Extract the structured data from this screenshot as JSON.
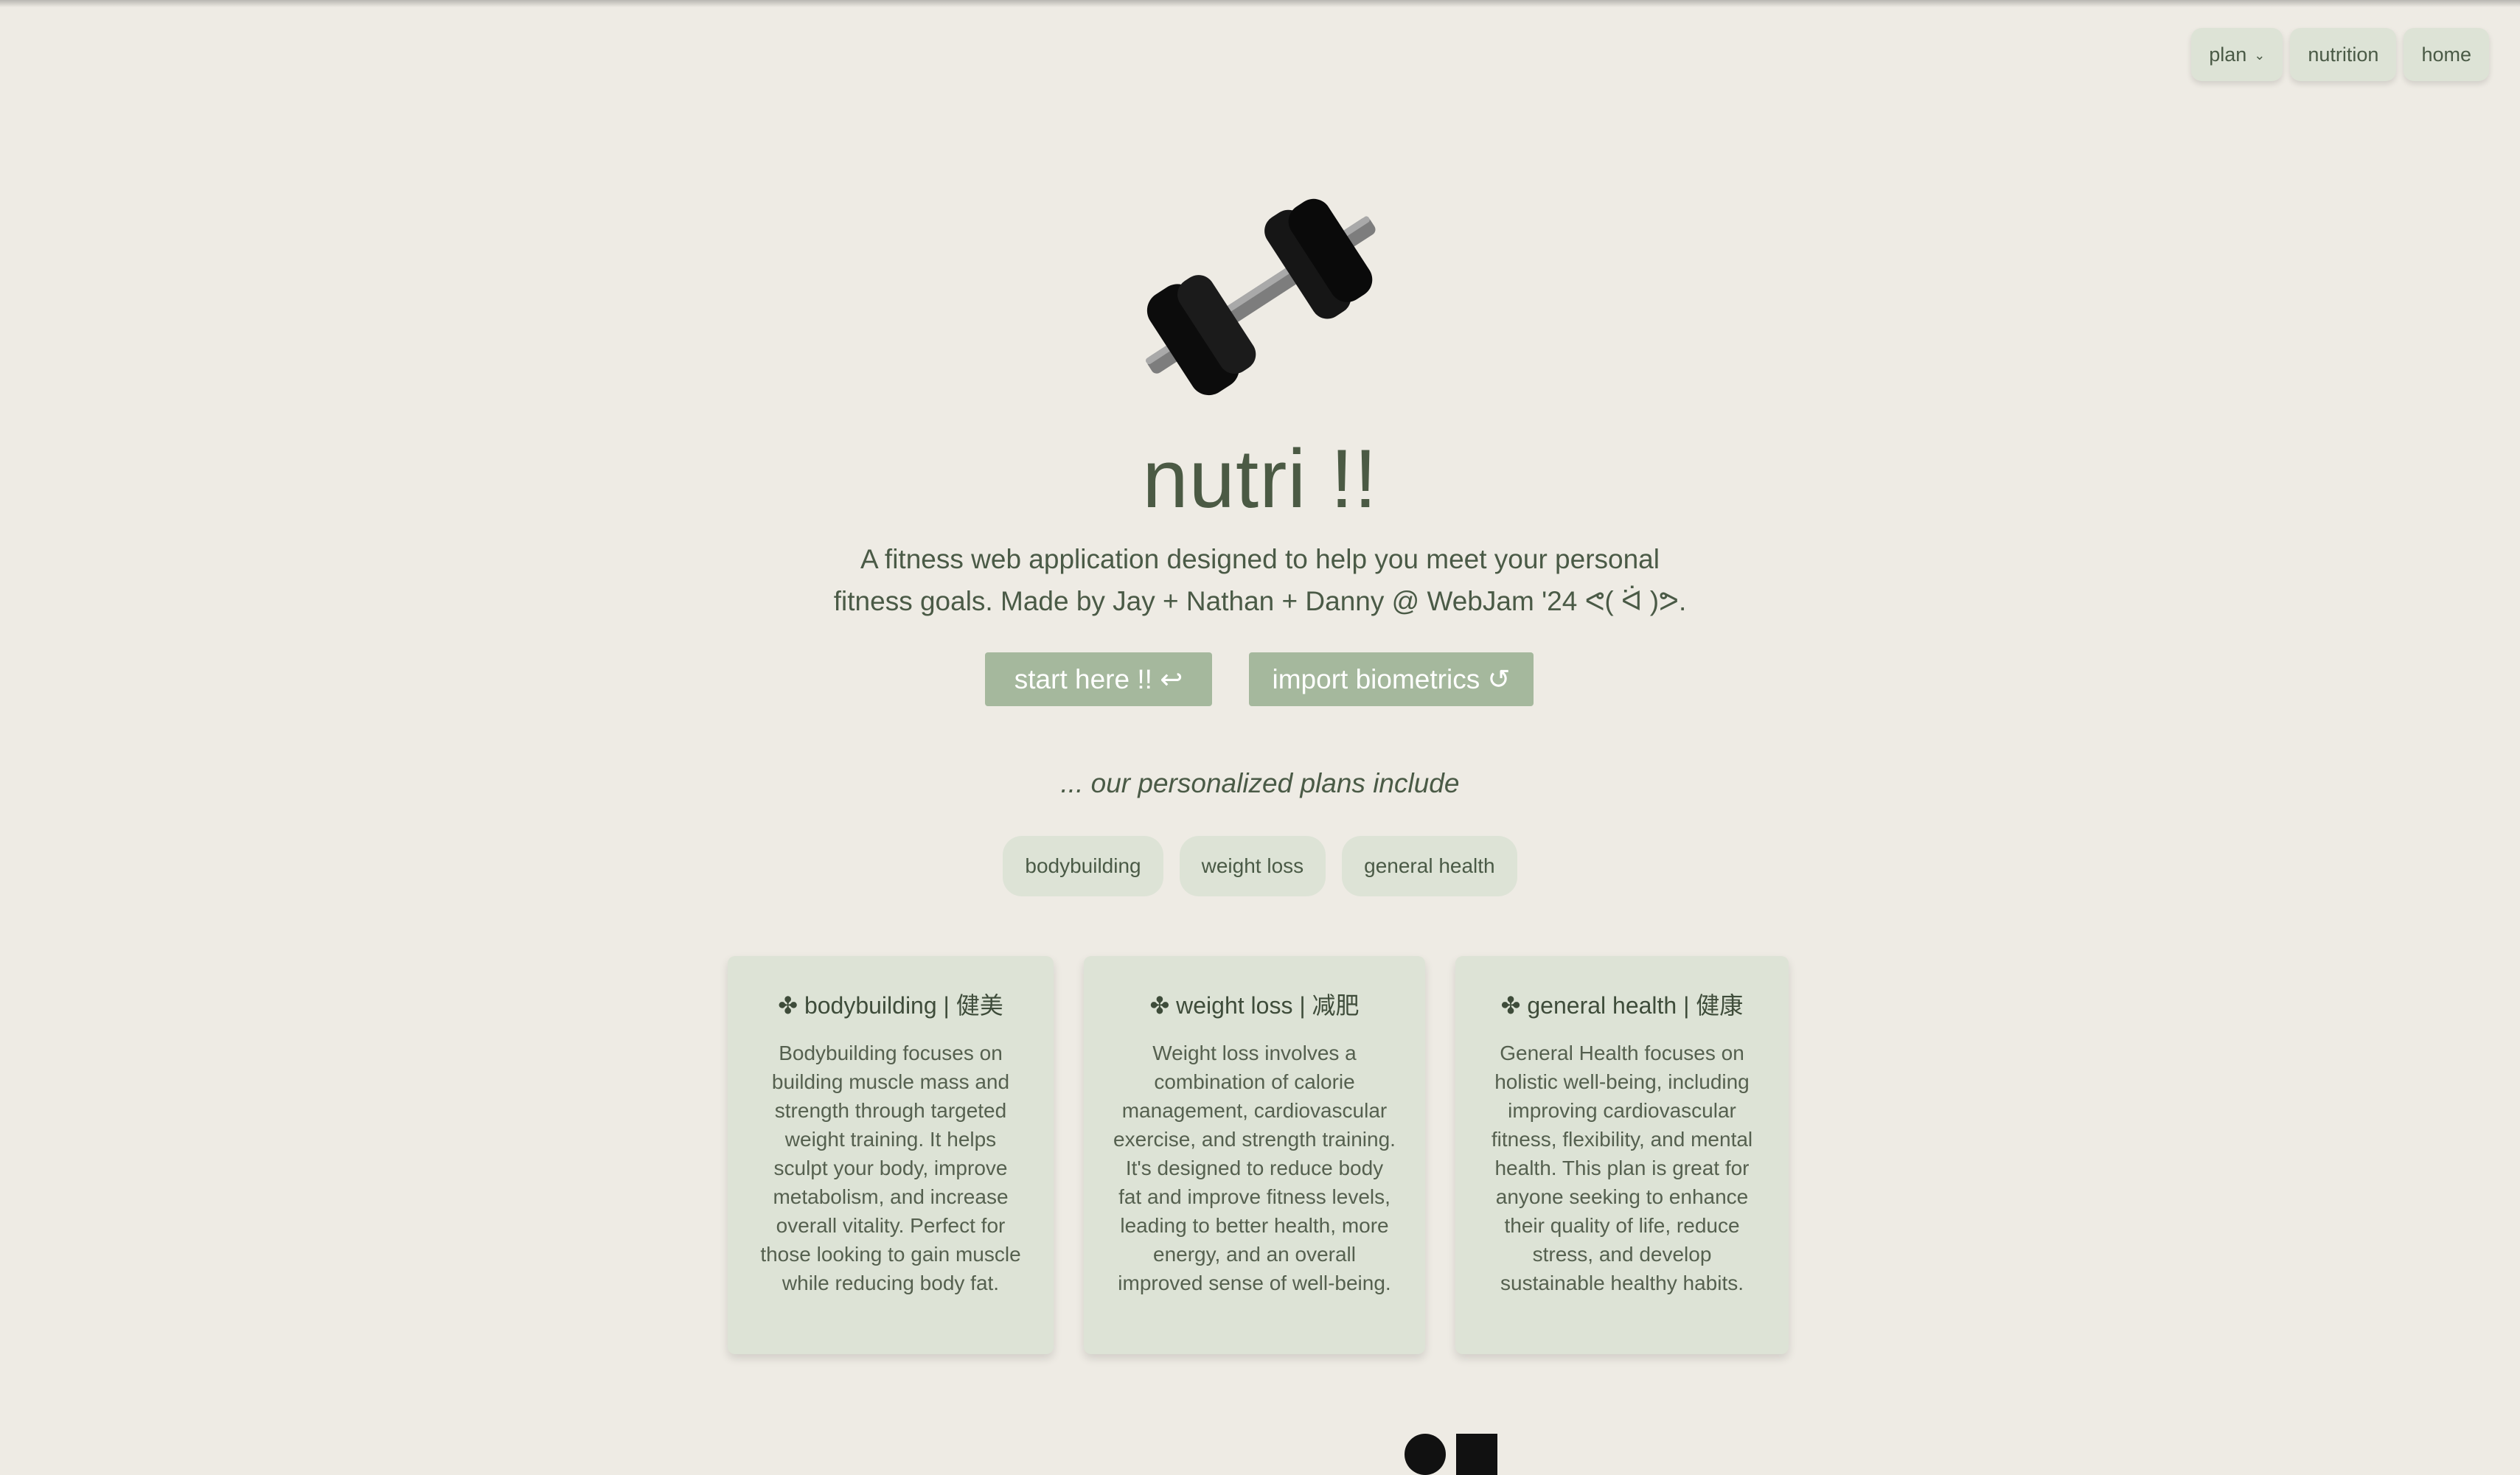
{
  "nav": {
    "plan_label": "plan",
    "nutrition_label": "nutrition",
    "home_label": "home",
    "plan_chevron": "chevron-down-icon"
  },
  "hero": {
    "logo_icon": "dumbbell-icon",
    "title": "nutri !!",
    "description_line1": "A fitness web application designed to help you meet your personal",
    "description_line2": "fitness goals. Made by Jay + Nathan + Danny @ WebJam '24 ᕙ( ᐛ )ᕗ.",
    "start_label": "start here !! ↩",
    "import_label": "import biometrics ↺"
  },
  "plans": {
    "subtitle": "... our personalized plans include",
    "chips": [
      "bodybuilding",
      "weight loss",
      "general health"
    ],
    "cards": [
      {
        "title": "✤ bodybuilding | 健美",
        "body": "Bodybuilding focuses on building muscle mass and strength through targeted weight training. It helps sculpt your body, improve metabolism, and increase overall vitality. Perfect for those looking to gain muscle while reducing body fat."
      },
      {
        "title": "✤ weight loss | 减肥",
        "body": "Weight loss involves a combination of calorie management, cardiovascular exercise, and strength training. It's designed to reduce body fat and improve fitness levels, leading to better health, more energy, and an overall improved sense of well-being."
      },
      {
        "title": "✤ general health | 健康",
        "body": "General Health focuses on holistic well-being, including improving cardiovascular fitness, flexibility, and mental health. This plan is great for anyone seeking to enhance their quality of life, reduce stress, and develop sustainable healthy habits."
      }
    ]
  },
  "colors": {
    "background": "#eeebe4",
    "accent": "#a5b89d",
    "chip": "#dde3d6",
    "text": "#4a5a46"
  }
}
